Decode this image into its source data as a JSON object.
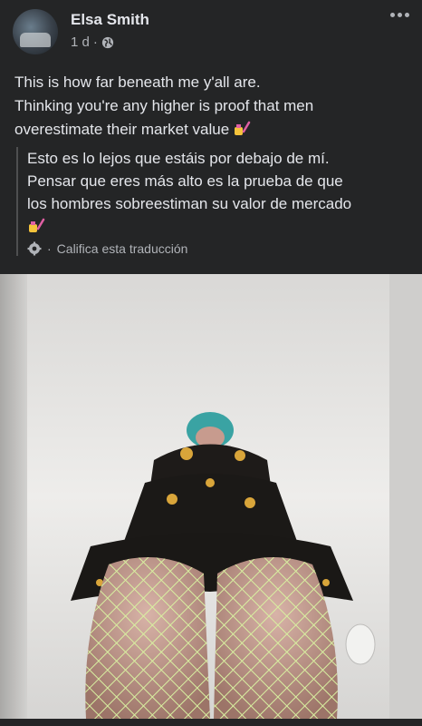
{
  "post": {
    "author": "Elsa Smith",
    "time": "1 d",
    "separator": "·",
    "text_line1": "This is how far beneath me y'all are.",
    "text_line2": "Thinking you're any higher is proof that men",
    "text_line3": "overestimate their market value",
    "emoji_icon": "nail-polish-icon"
  },
  "translation": {
    "line1": "Esto es lo lejos que estáis por debajo de mí.",
    "line2": "Pensar que eres más alto es la prueba de que",
    "line3": "los hombres sobreestiman su valor de mercado",
    "rate_label": "Califica esta traducción",
    "rate_separator": "·"
  },
  "colors": {
    "background": "#242526",
    "text_primary": "#e4e6eb",
    "text_secondary": "#b0b3b8"
  }
}
